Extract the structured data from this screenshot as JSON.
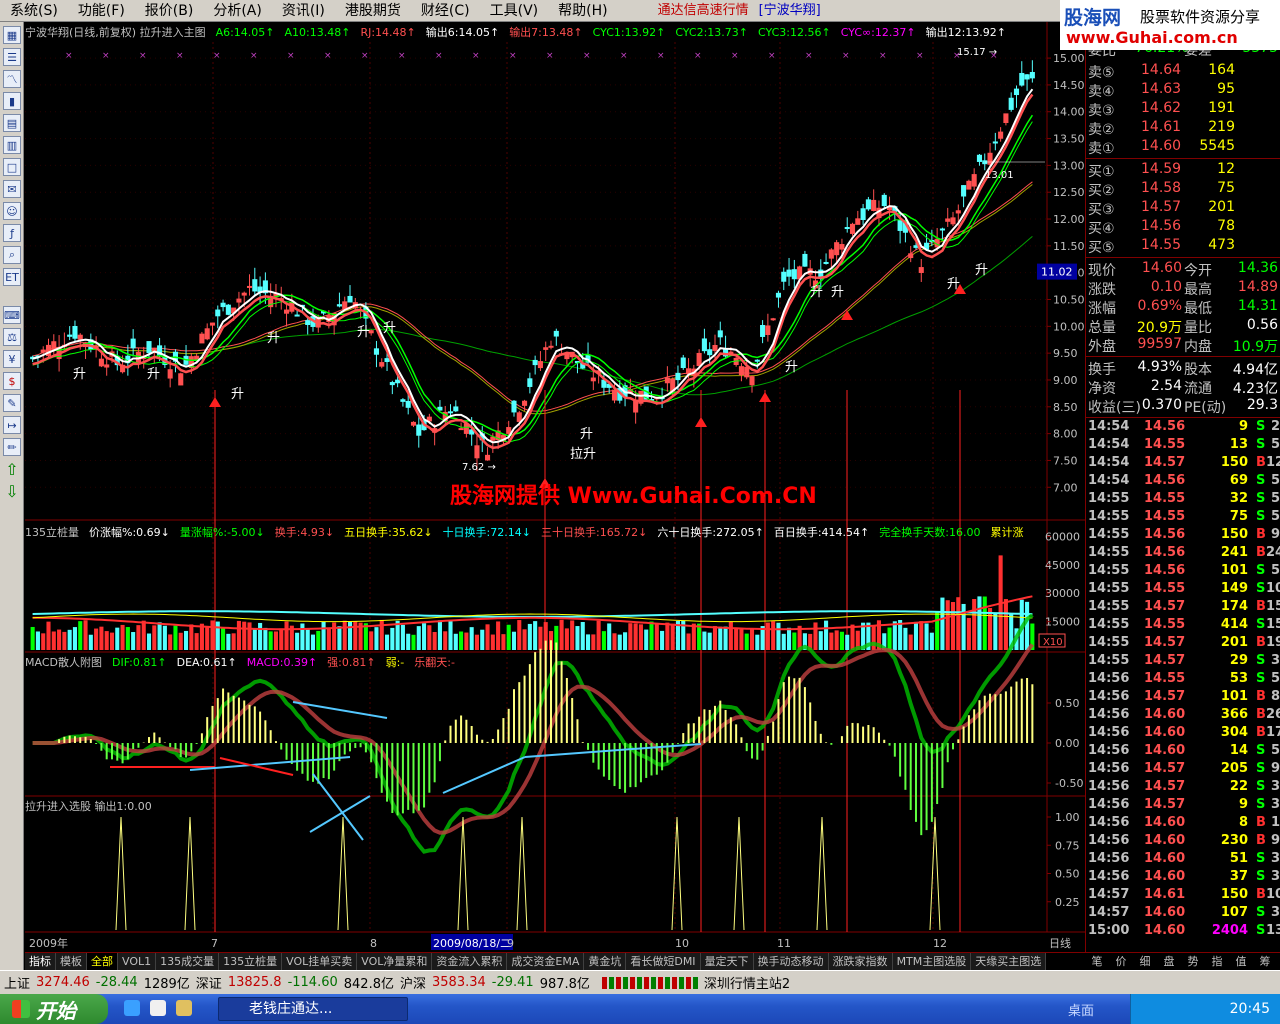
{
  "menu": {
    "items": [
      "系统(S)",
      "功能(F)",
      "报价(B)",
      "分析(A)",
      "资讯(I)",
      "港股期货",
      "财经(C)",
      "工具(V)",
      "帮助(H)"
    ],
    "realtime": "通达信高速行情",
    "stock": "[宁波华翔]"
  },
  "logo": {
    "line1": "股海网",
    "line1b": "股票软件资源分享",
    "line2": "www.Guhai.com.cn"
  },
  "header": {
    "main": [
      {
        "t": "宁波华翔(日线,前复权) 拉升进入主图",
        "c": "#c0c0c0"
      },
      {
        "t": "A6:14.05↑",
        "c": "#00ff00"
      },
      {
        "t": "A10:13.48↑",
        "c": "#00ff00"
      },
      {
        "t": "RJ:14.48↑",
        "c": "#ff5050"
      },
      {
        "t": "输出6:14.05↑",
        "c": "#ffffff"
      },
      {
        "t": "输出7:13.48↑",
        "c": "#ff5050"
      },
      {
        "t": "CYC1:13.92↑",
        "c": "#00ff00"
      },
      {
        "t": "CYC2:13.73↑",
        "c": "#00ff00"
      },
      {
        "t": "CYC3:12.56↑",
        "c": "#00ff00"
      },
      {
        "t": "CYC∞:12.37↑",
        "c": "#ff00ff"
      },
      {
        "t": "输出12:13.92↑",
        "c": "#ffffff"
      }
    ],
    "vol": [
      {
        "t": "135立桩量",
        "c": "#c0c0c0"
      },
      {
        "t": "价涨幅%:0.69↓",
        "c": "#ffffff"
      },
      {
        "t": "量涨幅%:-5.00↓",
        "c": "#00ff00"
      },
      {
        "t": "换手:4.93↓",
        "c": "#ff5050"
      },
      {
        "t": "五日换手:35.62↓",
        "c": "#ffff00"
      },
      {
        "t": "十日换手:72.14↓",
        "c": "#00ffff"
      },
      {
        "t": "三十日换手:165.72↓",
        "c": "#ff5050"
      },
      {
        "t": "六十日换手:272.05↑",
        "c": "#ffffff"
      },
      {
        "t": "百日换手:414.54↑",
        "c": "#ffffff"
      },
      {
        "t": "完全换手天数:16.00",
        "c": "#00ff00"
      },
      {
        "t": "累计涨",
        "c": "#ffff00"
      }
    ],
    "macd": [
      {
        "t": "MACD散人附图",
        "c": "#c0c0c0"
      },
      {
        "t": "DIF:0.81↑",
        "c": "#00ff00"
      },
      {
        "t": "DEA:0.61↑",
        "c": "#ffffff"
      },
      {
        "t": "MACD:0.39↑",
        "c": "#ff00ff"
      },
      {
        "t": "强:0.81↑",
        "c": "#ff5050"
      },
      {
        "t": "弱:-",
        "c": "#ffff00"
      },
      {
        "t": "乐翻天:-",
        "c": "#ff5050"
      }
    ],
    "signal": [
      {
        "t": "拉升进入选股 输出1:0.00",
        "c": "#c0c0c0"
      }
    ]
  },
  "watermark": "股海网提供 Www.Guhai.Com.CN",
  "chart_data": {
    "type": "candlestick",
    "price_axis": [
      "15.00",
      "14.50",
      "14.00",
      "13.50",
      "13.00",
      "12.50",
      "12.00",
      "11.50",
      "11.00",
      "10.50",
      "10.00",
      "9.50",
      "9.00",
      "8.50",
      "8.00",
      "7.50",
      "7.00"
    ],
    "current_price_tag": "11.02",
    "high_label": "15.17",
    "low_label": "7.62",
    "mark_label": "13.01",
    "vol_axis": [
      "60000",
      "45000",
      "30000",
      "15000"
    ],
    "vol_unit": "X10",
    "macd_axis": [
      "0.50",
      "0.00",
      "-0.50"
    ],
    "signal_axis": [
      "1.00",
      "0.75",
      "0.50",
      "0.25"
    ],
    "date_labels": [
      "2009年",
      "7",
      "8",
      "2009/08/18/二",
      "9",
      "10",
      "11",
      "12"
    ],
    "period": "日线",
    "signal_text": "升",
    "signal_text2": "拉升"
  },
  "quote": {
    "webi": {
      "label": "委比",
      "val": "-76.21%",
      "label2": "委差",
      "val2": "-5375"
    },
    "sell": [
      {
        "label": "卖⑤",
        "price": "14.64",
        "vol": "164"
      },
      {
        "label": "卖④",
        "price": "14.63",
        "vol": "95"
      },
      {
        "label": "卖③",
        "price": "14.62",
        "vol": "191"
      },
      {
        "label": "卖②",
        "price": "14.61",
        "vol": "219"
      },
      {
        "label": "卖①",
        "price": "14.60",
        "vol": "5545"
      }
    ],
    "buy": [
      {
        "label": "买①",
        "price": "14.59",
        "vol": "12"
      },
      {
        "label": "买②",
        "price": "14.58",
        "vol": "75"
      },
      {
        "label": "买③",
        "price": "14.57",
        "vol": "201"
      },
      {
        "label": "买④",
        "price": "14.56",
        "vol": "78"
      },
      {
        "label": "买⑤",
        "price": "14.55",
        "vol": "473"
      }
    ],
    "stats": [
      {
        "a": "现价",
        "b": "14.60",
        "bc": "#ff5050",
        "c": "今开",
        "d": "14.36",
        "dc": "#00ff00"
      },
      {
        "a": "涨跌",
        "b": "0.10",
        "bc": "#ff5050",
        "c": "最高",
        "d": "14.89",
        "dc": "#ff5050"
      },
      {
        "a": "涨幅",
        "b": "0.69%",
        "bc": "#ff5050",
        "c": "最低",
        "d": "14.31",
        "dc": "#00ff00"
      },
      {
        "a": "总量",
        "b": "20.9万",
        "bc": "#ffff00",
        "c": "量比",
        "d": "0.56",
        "dc": "#ffffff"
      },
      {
        "a": "外盘",
        "b": "99597",
        "bc": "#ff5050",
        "c": "内盘",
        "d": "10.9万",
        "dc": "#00ff00"
      }
    ],
    "stats2": [
      {
        "a": "换手",
        "b": "4.93%",
        "bc": "#ffffff",
        "c": "股本",
        "d": "4.94亿",
        "dc": "#ffffff"
      },
      {
        "a": "净资",
        "b": "2.54",
        "bc": "#ffffff",
        "c": "流通",
        "d": "4.23亿",
        "dc": "#ffffff"
      },
      {
        "a": "收益(三)",
        "b": "0.370",
        "bc": "#ffffff",
        "c": "PE(动)",
        "d": "29.3",
        "dc": "#ffffff"
      }
    ],
    "ticks": [
      {
        "t": "14:54",
        "p": "14.56",
        "v": "9",
        "s": "S",
        "n": "2"
      },
      {
        "t": "14:54",
        "p": "14.55",
        "v": "13",
        "s": "S",
        "n": "5"
      },
      {
        "t": "14:54",
        "p": "14.57",
        "v": "150",
        "s": "B",
        "n": "12"
      },
      {
        "t": "14:54",
        "p": "14.56",
        "v": "69",
        "s": "S",
        "n": "5"
      },
      {
        "t": "14:55",
        "p": "14.55",
        "v": "32",
        "s": "S",
        "n": "5"
      },
      {
        "t": "14:55",
        "p": "14.55",
        "v": "75",
        "s": "S",
        "n": "5"
      },
      {
        "t": "14:55",
        "p": "14.56",
        "v": "150",
        "s": "B",
        "n": "9"
      },
      {
        "t": "14:55",
        "p": "14.56",
        "v": "241",
        "s": "B",
        "n": "24"
      },
      {
        "t": "14:55",
        "p": "14.56",
        "v": "101",
        "s": "S",
        "n": "5"
      },
      {
        "t": "14:55",
        "p": "14.55",
        "v": "149",
        "s": "S",
        "n": "10"
      },
      {
        "t": "14:55",
        "p": "14.57",
        "v": "174",
        "s": "B",
        "n": "15"
      },
      {
        "t": "14:55",
        "p": "14.55",
        "v": "414",
        "s": "S",
        "n": "15"
      },
      {
        "t": "14:55",
        "p": "14.57",
        "v": "201",
        "s": "B",
        "n": "19"
      },
      {
        "t": "14:55",
        "p": "14.57",
        "v": "29",
        "s": "S",
        "n": "3"
      },
      {
        "t": "14:56",
        "p": "14.55",
        "v": "53",
        "s": "S",
        "n": "5"
      },
      {
        "t": "14:56",
        "p": "14.57",
        "v": "101",
        "s": "B",
        "n": "8"
      },
      {
        "t": "14:56",
        "p": "14.60",
        "v": "366",
        "s": "B",
        "n": "26"
      },
      {
        "t": "14:56",
        "p": "14.60",
        "v": "304",
        "s": "B",
        "n": "17"
      },
      {
        "t": "14:56",
        "p": "14.60",
        "v": "14",
        "s": "S",
        "n": "5"
      },
      {
        "t": "14:56",
        "p": "14.57",
        "v": "205",
        "s": "S",
        "n": "9"
      },
      {
        "t": "14:56",
        "p": "14.57",
        "v": "22",
        "s": "S",
        "n": "3"
      },
      {
        "t": "14:56",
        "p": "14.57",
        "v": "9",
        "s": "S",
        "n": "3"
      },
      {
        "t": "14:56",
        "p": "14.60",
        "v": "8",
        "s": "B",
        "n": "1"
      },
      {
        "t": "14:56",
        "p": "14.60",
        "v": "230",
        "s": "B",
        "n": "9"
      },
      {
        "t": "14:56",
        "p": "14.60",
        "v": "51",
        "s": "S",
        "n": "3"
      },
      {
        "t": "14:56",
        "p": "14.60",
        "v": "37",
        "s": "S",
        "n": "3"
      },
      {
        "t": "14:57",
        "p": "14.61",
        "v": "150",
        "s": "B",
        "n": "10"
      },
      {
        "t": "14:57",
        "p": "14.60",
        "v": "107",
        "s": "S",
        "n": "3"
      },
      {
        "t": "15:00",
        "p": "14.60",
        "v": "2404",
        "s": "S",
        "n": "139"
      }
    ]
  },
  "tabs": [
    "指标",
    "模板",
    "全部",
    "VOL1",
    "135成交量",
    "135立桩量",
    "VOL挂单买卖",
    "VOL净量累和",
    "资金流入累积",
    "成交资金EMA",
    "黄金坑",
    "看长做短DMI",
    "量定天下",
    "换手动态移动",
    "涨跌家指数",
    "MTM主图选股",
    "天缘买主图选"
  ],
  "rtabs": [
    "笔",
    "价",
    "细",
    "盘",
    "势",
    "指",
    "值",
    "筹"
  ],
  "status": {
    "sh_label": "上证",
    "sh_val": "3274.46",
    "sh_chg": "-28.44",
    "sh_amt": "1289亿",
    "sz_label": "深证",
    "sz_val": "13825.8",
    "sz_chg": "-114.60",
    "sz_amt": "842.8亿",
    "hs_label": "沪深",
    "hs_val": "3583.34",
    "hs_chg": "-29.41",
    "hs_amt": "987.8亿",
    "server": "深圳行情主站2"
  },
  "taskbar": {
    "start": "开始",
    "app": "老钱庄通达...",
    "desk": "桌面",
    "time": "20:45"
  },
  "colors": {
    "up": "#ff5050",
    "down": "#54ffff",
    "bg": "#000000",
    "grid": "#800000"
  }
}
